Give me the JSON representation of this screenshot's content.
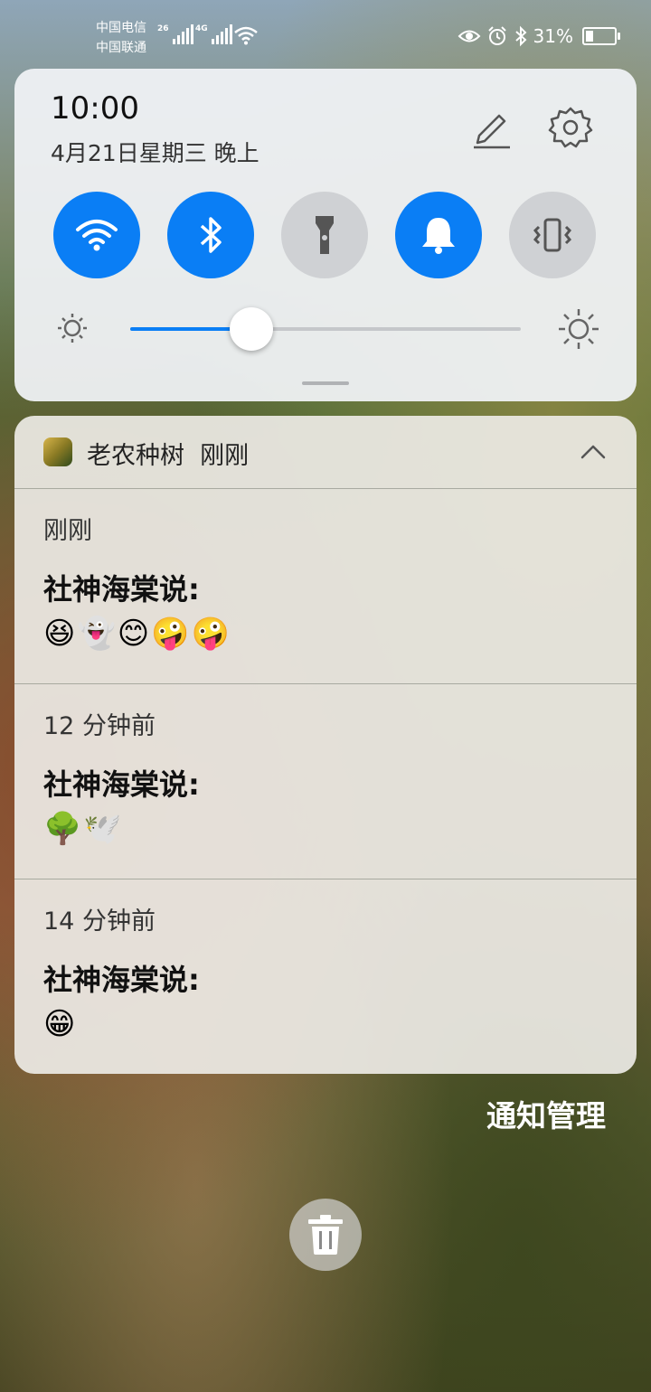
{
  "status_bar": {
    "carrier1": "中国电信",
    "carrier2": "中国联通",
    "net1": "26",
    "net2": "4G",
    "battery": "31%",
    "battery_level": 0.31,
    "icons": [
      "eye-comfort-icon",
      "alarm-icon",
      "bluetooth-icon",
      "battery-icon"
    ]
  },
  "quick_settings": {
    "time": "10:00",
    "date": "4月21日星期三 晚上",
    "toggles": [
      {
        "name": "wifi",
        "icon": "wifi-icon",
        "state": "on"
      },
      {
        "name": "bluetooth",
        "icon": "bluetooth-icon",
        "state": "on"
      },
      {
        "name": "flashlight",
        "icon": "flashlight-icon",
        "state": "off"
      },
      {
        "name": "sound",
        "icon": "bell-icon",
        "state": "on"
      },
      {
        "name": "vibrate",
        "icon": "vibrate-icon",
        "state": "off"
      }
    ],
    "brightness_level": 0.31,
    "accent": "#0a7ef5"
  },
  "notification": {
    "app_name": "老农种树",
    "app_time": "刚刚",
    "messages": [
      {
        "time": "刚刚",
        "title": "社神海棠说:",
        "body": "😆👻😊🤪🤪"
      },
      {
        "time": "12 分钟前",
        "title": "社神海棠说:",
        "body": "🌳🕊️"
      },
      {
        "time": "14 分钟前",
        "title": "社神海棠说:",
        "body": "😁"
      }
    ]
  },
  "footer": {
    "manage_label": "通知管理"
  }
}
